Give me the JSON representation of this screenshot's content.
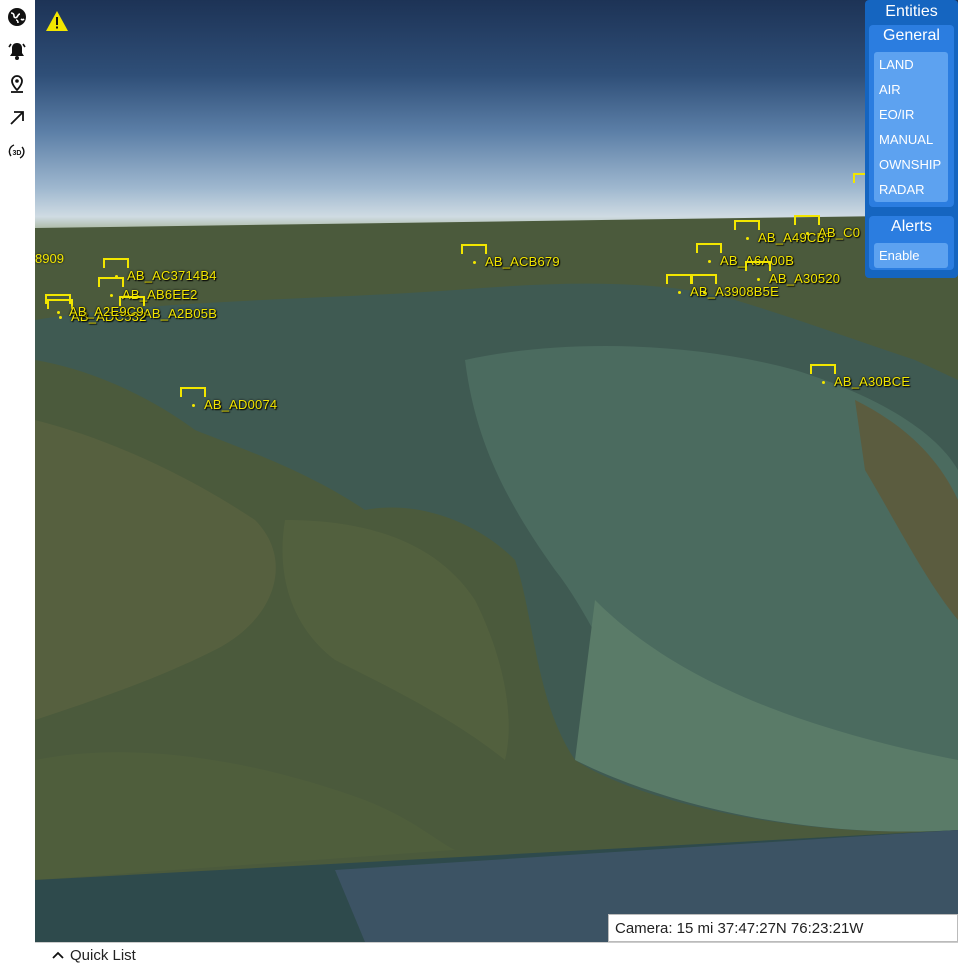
{
  "toolbar": {
    "tools": [
      {
        "icon": "globe-icon"
      },
      {
        "icon": "alarm-bell-icon"
      },
      {
        "icon": "location-pin-icon"
      },
      {
        "icon": "arrow-up-right-icon"
      },
      {
        "icon": "3d-rotate-icon",
        "label": "3D"
      }
    ]
  },
  "map": {
    "warning_icon": "warning-icon",
    "accent_color": "#f2e600",
    "entities": [
      {
        "label": "AB_ACB679"
      },
      {
        "label": "AB_AD0074"
      },
      {
        "label": "AB_A30BCE"
      },
      {
        "label": "AB_A6A00B"
      },
      {
        "label": "AB_A30520"
      },
      {
        "label": "AB_A49CB7"
      },
      {
        "label": "AB_C0"
      },
      {
        "label": "AB_AB6EE2"
      },
      {
        "label": "AB_AC3714B4"
      },
      {
        "label": "AB_A2B05B"
      },
      {
        "label": "AB_ADC532"
      },
      {
        "label": "AB_A2E9C9"
      },
      {
        "label": "AB_A3908B5E"
      },
      {
        "label": "8909"
      }
    ]
  },
  "panel": {
    "title": "Entities",
    "general": {
      "title": "General",
      "items": [
        "LAND",
        "AIR",
        "EO/IR",
        "MANUAL",
        "OWNSHIP",
        "RADAR"
      ]
    },
    "alerts": {
      "title": "Alerts",
      "items": [
        "Enable"
      ]
    },
    "color": "#1565c0"
  },
  "camera": {
    "readout": "Camera: 15 mi 37:47:27N 76:23:21W"
  },
  "quick_list": {
    "label": "Quick List"
  }
}
